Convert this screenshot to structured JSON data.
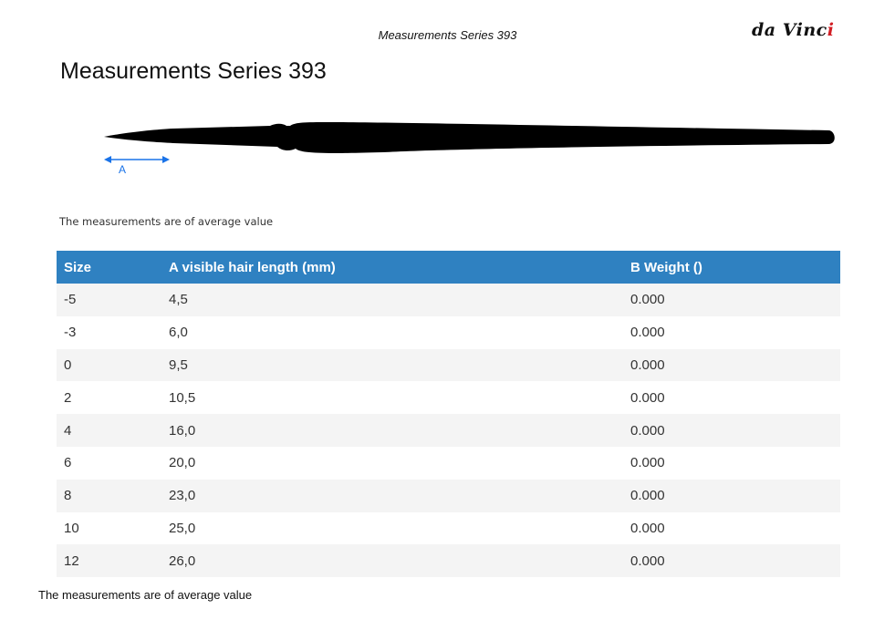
{
  "header": {
    "title": "Measurements Series 393",
    "brand": "da Vinci"
  },
  "page_title": "Measurements Series 393",
  "diagram": {
    "marker_label": "A",
    "arrow_color": "#1a73e8",
    "brush_color": "#000000"
  },
  "note_top": "The measurements are of average value",
  "table": {
    "header_color": "#2f81c1",
    "columns": [
      "Size",
      "A visible hair length (mm)",
      "B Weight ()"
    ],
    "rows": [
      {
        "size": "-5",
        "length": "4,5",
        "weight": "0.000"
      },
      {
        "size": "-3",
        "length": "6,0",
        "weight": "0.000"
      },
      {
        "size": "0",
        "length": "9,5",
        "weight": "0.000"
      },
      {
        "size": "2",
        "length": "10,5",
        "weight": "0.000"
      },
      {
        "size": "4",
        "length": "16,0",
        "weight": "0.000"
      },
      {
        "size": "6",
        "length": "20,0",
        "weight": "0.000"
      },
      {
        "size": "8",
        "length": "23,0",
        "weight": "0.000"
      },
      {
        "size": "10",
        "length": "25,0",
        "weight": "0.000"
      },
      {
        "size": "12",
        "length": "26,0",
        "weight": "0.000"
      }
    ]
  },
  "note_bottom": "The measurements are of average value"
}
